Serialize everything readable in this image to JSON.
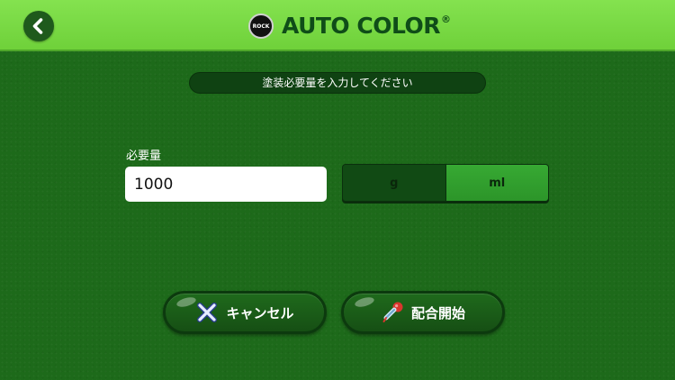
{
  "header": {
    "logo_badge": "ROCK",
    "logo_text": "AUTO COLOR",
    "logo_mark": "®",
    "back_icon": "chevron-left-icon"
  },
  "instruction": "塗装必要量を入力してください",
  "amount": {
    "label": "必要量",
    "value": "1000"
  },
  "units": {
    "options": [
      "g",
      "ml"
    ],
    "selected": "ml"
  },
  "buttons": {
    "cancel_label": "キャンセル",
    "cancel_icon": "close-x-icon",
    "start_label": "配合開始",
    "start_icon": "dropper-icon"
  },
  "colors": {
    "header": "#77d844",
    "background": "#1d6a1a",
    "selected_unit": "#2f9c2c"
  }
}
